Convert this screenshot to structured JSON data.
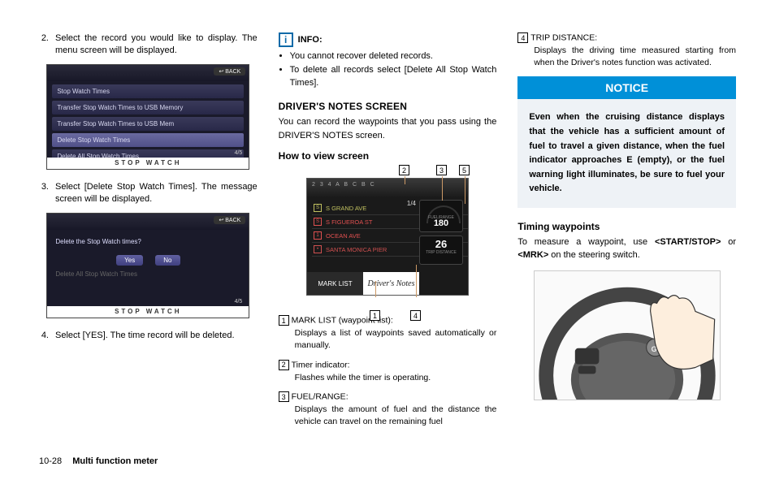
{
  "col1": {
    "step2": {
      "num": "2.",
      "text": "Select the record you would like to display. The menu screen will be displayed."
    },
    "step3": {
      "num": "3.",
      "text": "Select [Delete Stop Watch Times]. The message screen will be displayed."
    },
    "step4": {
      "num": "4.",
      "text": "Select [YES]. The time record will be deleted."
    },
    "screen1": {
      "back": "↩ BACK",
      "items": [
        "Stop Watch Times",
        "Transfer Stop Watch Times to USB Memory",
        "Transfer Stop Watch Times to USB Mem",
        "Delete Stop Watch Times",
        "Delete All Stop Watch Times"
      ],
      "pager": "4/5",
      "footer": "STOP WATCH"
    },
    "screen2": {
      "back": "↩ BACK",
      "question": "Delete the Stop Watch times?",
      "yes": "Yes",
      "no": "No",
      "greyed": "Delete All Stop Watch Times",
      "pager": "4/5",
      "footer": "STOP WATCH"
    }
  },
  "col2": {
    "info_label": "INFO:",
    "bullets": [
      "You cannot recover deleted records.",
      "To delete all records select [Delete All Stop Watch Times]."
    ],
    "h_section": "DRIVER'S NOTES SCREEN",
    "section_para": "You can record the waypoints that you pass using the DRIVER'S NOTES screen.",
    "h_sub": "How to view screen",
    "screen3": {
      "topscale": "2 3 4 A B C B C",
      "counter": "1/4",
      "rows": [
        "S GRAND AVE",
        "S FIGUEROA ST",
        "OCEAN AVE",
        "SANTA MONICA PIER"
      ],
      "fuel_val": "180",
      "fuel_lab": "FUEL/RANGE",
      "trip_val": "26",
      "trip_lab": "TRIP DISTANCE",
      "marklist": "MARK LIST",
      "title": "Driver's Notes"
    },
    "callouts": {
      "1": "1",
      "2": "2",
      "3": "3",
      "4": "4",
      "5": "5"
    },
    "defs": [
      {
        "n": "1",
        "label": "MARK LIST (waypoint list):",
        "desc": "Displays a list of waypoints saved automatically or manually."
      },
      {
        "n": "2",
        "label": "Timer indicator:",
        "desc": "Flashes while the timer is operating."
      },
      {
        "n": "3",
        "label": "FUEL/RANGE:",
        "desc": "Displays the amount of fuel and the distance the vehicle can travel on the remaining fuel"
      }
    ]
  },
  "col3": {
    "def4": {
      "n": "4",
      "label": "TRIP DISTANCE:",
      "desc": "Displays the driving time measured starting from when the Driver's notes function was activated."
    },
    "notice_title": "NOTICE",
    "notice_body": "Even when the cruising distance displays that the vehicle has a sufficient amount of fuel to travel a given distance, when the fuel indicator approaches E (empty), or the fuel warning light illuminates, be sure to fuel your vehicle.",
    "h_timing": "Timing waypoints",
    "timing_para_a": "To measure a waypoint, use ",
    "timing_ss": "<START/STOP>",
    "timing_or": " or ",
    "timing_mrk": "<MRK>",
    "timing_para_b": " on the steering switch."
  },
  "footer": {
    "page": "10-28",
    "section": "Multi function meter"
  }
}
